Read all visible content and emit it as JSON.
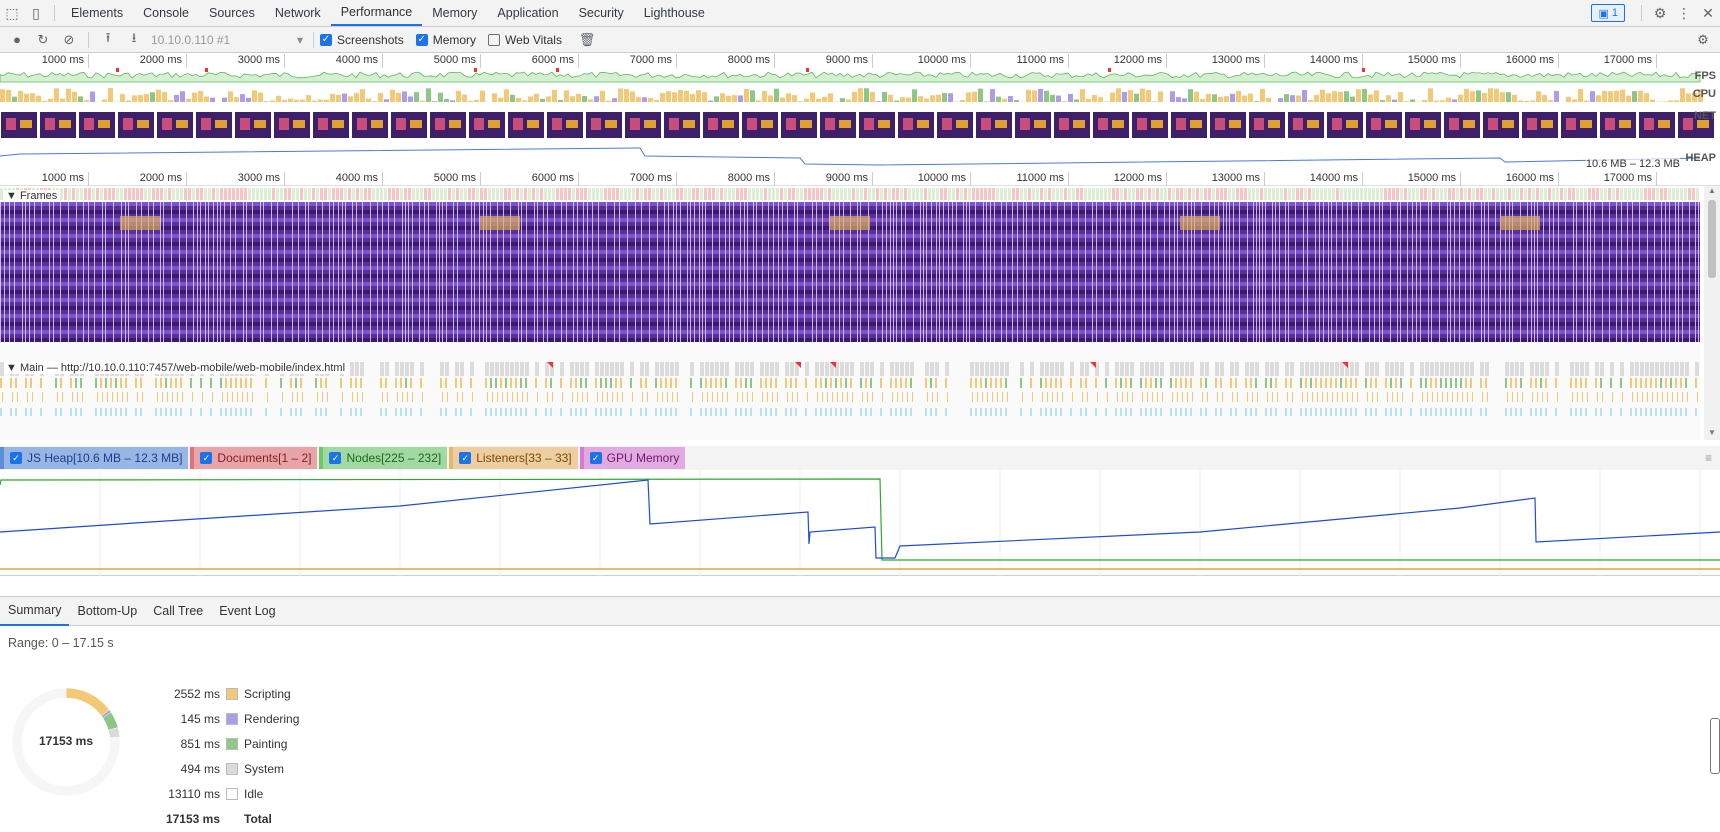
{
  "tabs": {
    "items": [
      "Elements",
      "Console",
      "Sources",
      "Network",
      "Performance",
      "Memory",
      "Application",
      "Security",
      "Lighthouse"
    ],
    "active": "Performance",
    "issues_count": "1"
  },
  "toolbar": {
    "recording_select": "10.10.0.110 #1",
    "screenshots_label": "Screenshots",
    "memory_label": "Memory",
    "web_vitals_label": "Web Vitals"
  },
  "overview": {
    "ticks": [
      "1000 ms",
      "2000 ms",
      "3000 ms",
      "4000 ms",
      "5000 ms",
      "6000 ms",
      "7000 ms",
      "8000 ms",
      "9000 ms",
      "10000 ms",
      "11000 ms",
      "12000 ms",
      "13000 ms",
      "14000 ms",
      "15000 ms",
      "16000 ms",
      "17000 ms"
    ],
    "track_fps": "FPS",
    "track_cpu": "CPU",
    "track_net": "NET",
    "track_heap": "HEAP",
    "heap_range": "10.6 MB – 12.3 MB"
  },
  "flame": {
    "frames_label": "Frames",
    "main_label": "Main — http://10.10.0.110:7457/web-mobile/web-mobile/index.html"
  },
  "counters": [
    {
      "label": "JS Heap[10.6 MB – 12.3 MB]",
      "color": "#5b8dd8",
      "text": "#1b3f8f"
    },
    {
      "label": "Documents[1 – 2]",
      "color": "#e0727a",
      "text": "#8a1c22"
    },
    {
      "label": "Nodes[225 – 232]",
      "color": "#6cc86c",
      "text": "#1b6a1b"
    },
    {
      "label": "Listeners[33 – 33]",
      "color": "#e8b66a",
      "text": "#7a4a00"
    },
    {
      "label": "GPU Memory",
      "color": "#d67ad6",
      "text": "#6d1a6d"
    }
  ],
  "bottom_tabs": {
    "items": [
      "Summary",
      "Bottom-Up",
      "Call Tree",
      "Event Log"
    ],
    "active": "Summary"
  },
  "summary": {
    "range": "Range: 0 – 17.15 s",
    "total_center": "17153 ms",
    "rows": [
      {
        "value": "2552 ms",
        "label": "Scripting",
        "color": "#f2c977"
      },
      {
        "value": "145 ms",
        "label": "Rendering",
        "color": "#af9ce6"
      },
      {
        "value": "851 ms",
        "label": "Painting",
        "color": "#8dc685"
      },
      {
        "value": "494 ms",
        "label": "System",
        "color": "#dadada"
      },
      {
        "value": "13110 ms",
        "label": "Idle",
        "color": "#ffffff"
      },
      {
        "value": "17153 ms",
        "label": "Total",
        "color": ""
      }
    ]
  }
}
